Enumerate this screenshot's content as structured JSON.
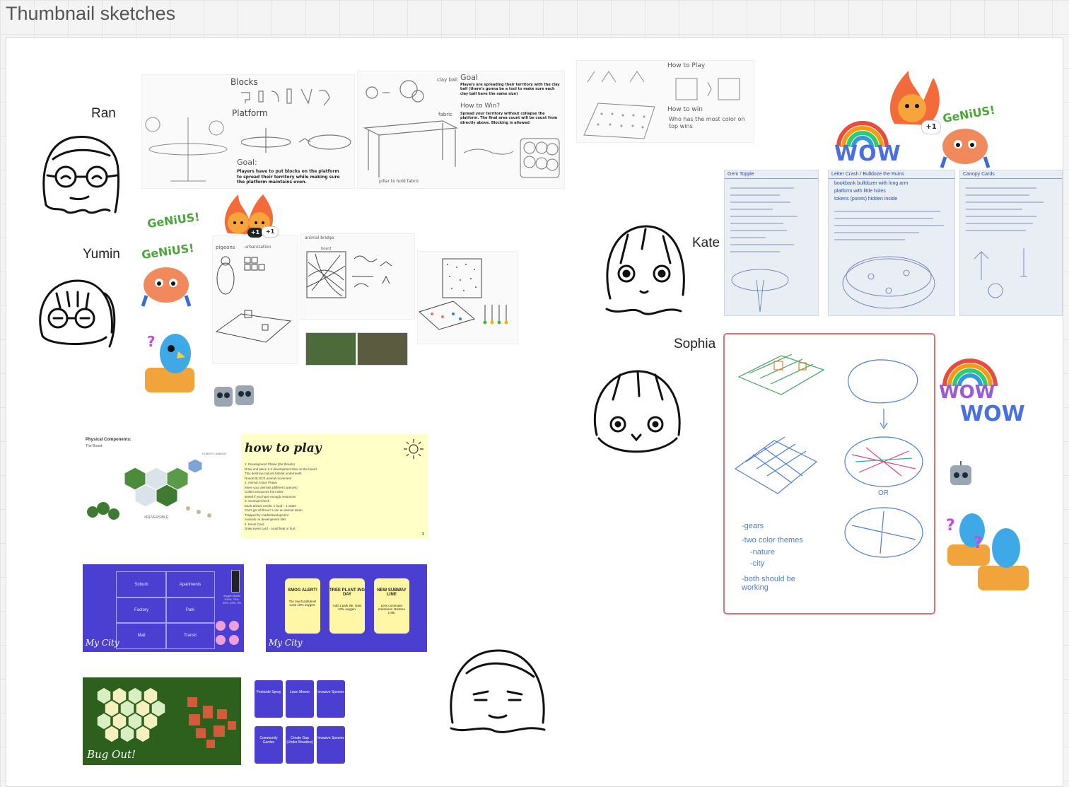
{
  "board": {
    "title": "Thumbnail sketches"
  },
  "people": {
    "ran": "Ran",
    "yumin": "Yumin",
    "kate": "Kate",
    "sophia": "Sophia"
  },
  "ran_sketches": {
    "blocks": "Blocks",
    "platform": "Platform",
    "goal_heading": "Goal:",
    "goal_text": "Players have to put blocks on the platform to spread their territory while making sure the platform maintains even.",
    "clay_ball": "clay ball",
    "fabric": "fabric",
    "pillar": "pillar to hold fabric",
    "goal2_heading": "Goal",
    "goal2_text": "Players are spreading their territory with the clay ball (there's gonna be a tool to make sure each clay ball have the same size)",
    "howtowin_heading": "How to Win?",
    "howtowin_text": "Spread your territory without collapse the platform. The final area count will be count from directly above. Blocking is allowed",
    "how_to_play": "How to Play",
    "how_to_win": "How to win",
    "who_has": "Who has the most color on top wins"
  },
  "yumin_sketches": {
    "pigeons": "pigeons",
    "urbanization": "urbanization",
    "board": "board",
    "bridge": "animal bridge"
  },
  "kate_photos": {
    "p1_header": "Gem Topple",
    "p2_header": "Letter Crash / Bulldoze the Ruins",
    "p3_header": "Canopy Cards",
    "p2_line1": "bookbank bulldozer with long arm",
    "p2_line2": "platform with little holes",
    "p2_line3": "tokens (points) hidden inside"
  },
  "sophia_sketch": {
    "or": "OR",
    "note1": "-gears",
    "note2": "-two color themes",
    "note3": "-nature",
    "note4": "-city",
    "note5": "-both should be working"
  },
  "physical_components": {
    "title": "Physical Components:",
    "line1": "The Board:",
    "label_forest": "FOREST/ HABITAT",
    "label_reversible": "#REVERSIBLE"
  },
  "how_to_play_slide": {
    "title": "how to play",
    "page": "3",
    "lines": [
      "1. Development Phase (the threats)",
      "Draw and place 2-3 development tiles on the board",
      "This destroys natural habitat underneath",
      "Roads BLOCK animal movement",
      "2. Animal Action Phase",
      "Move your animals (different species)",
      "Collect resources from tiles",
      "Breed if you have enough resources",
      "3. Survival Check",
      "Each animal needs: 1 food + 1 water",
      "Can't get all three? Lose an animal token",
      "Trapped by roads/development",
      "Animals on development tiles",
      "4. Event Card",
      "Draw event card - could help or hurt"
    ]
  },
  "mycity_board": {
    "cells": [
      "Suburb",
      "Apartments",
      "Factory",
      "Park",
      "Mall",
      "Transit"
    ],
    "label": "My City",
    "meter": "oxygen levels 100%, 75%, 50%, 25%, 0%"
  },
  "mycity_cards": {
    "label": "My City",
    "cards": [
      {
        "title": "SMOG ALERT!",
        "desc": "Too much pollution! Lose 10% oxygen."
      },
      {
        "title": "TREE PLANT ING DAY",
        "desc": "Add 1 park tile. Gain 10% oxygen."
      },
      {
        "title": "NEW SUBWAY LINE",
        "desc": "Less commuter emissions. Restore 1 tile."
      }
    ]
  },
  "bugout_board": {
    "label": "Bug Out!"
  },
  "bugout_cards": {
    "cards": [
      "Pesticide Spray",
      "Lawn Mower",
      "Invasive Species",
      "Community Garden",
      "Create Gap (Under Meadow)",
      "Invasive Species"
    ]
  },
  "stickers": {
    "genius": "GeNiUS!",
    "wow": "WOW",
    "plus_one": "+1"
  },
  "colors": {
    "board_blue": "#4b3fd1",
    "bugout_green": "#2d5f1d",
    "highlight_red": "#e27272",
    "yellow_slide": "#ffffc8"
  }
}
